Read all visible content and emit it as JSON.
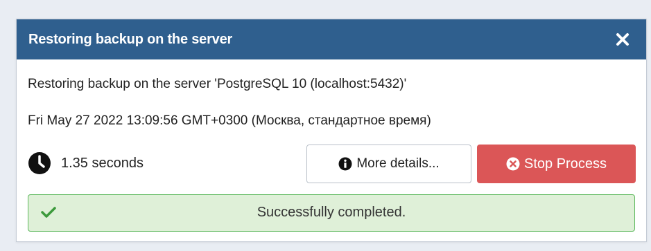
{
  "dialog": {
    "title": "Restoring backup on the server",
    "description": "Restoring backup on the server 'PostgreSQL 10 (localhost:5432)'",
    "start_time": "Fri May 27 2022 13:09:56 GMT+0300 (Москва, стандартное время)",
    "elapsed": "1.35 seconds",
    "more_details_label": "More details...",
    "stop_label": "Stop Process",
    "status_message": "Successfully completed."
  },
  "icons": {
    "close": "close-icon",
    "clock": "clock-icon",
    "info": "info-circle-icon",
    "stop": "times-circle-icon",
    "check": "check-icon"
  },
  "colors": {
    "header_bg": "#2f5f8e",
    "stop_button_bg": "#db5657",
    "success_bg": "#dff0d8",
    "success_border": "#5cb85c",
    "success_check": "#3c9a3c"
  }
}
